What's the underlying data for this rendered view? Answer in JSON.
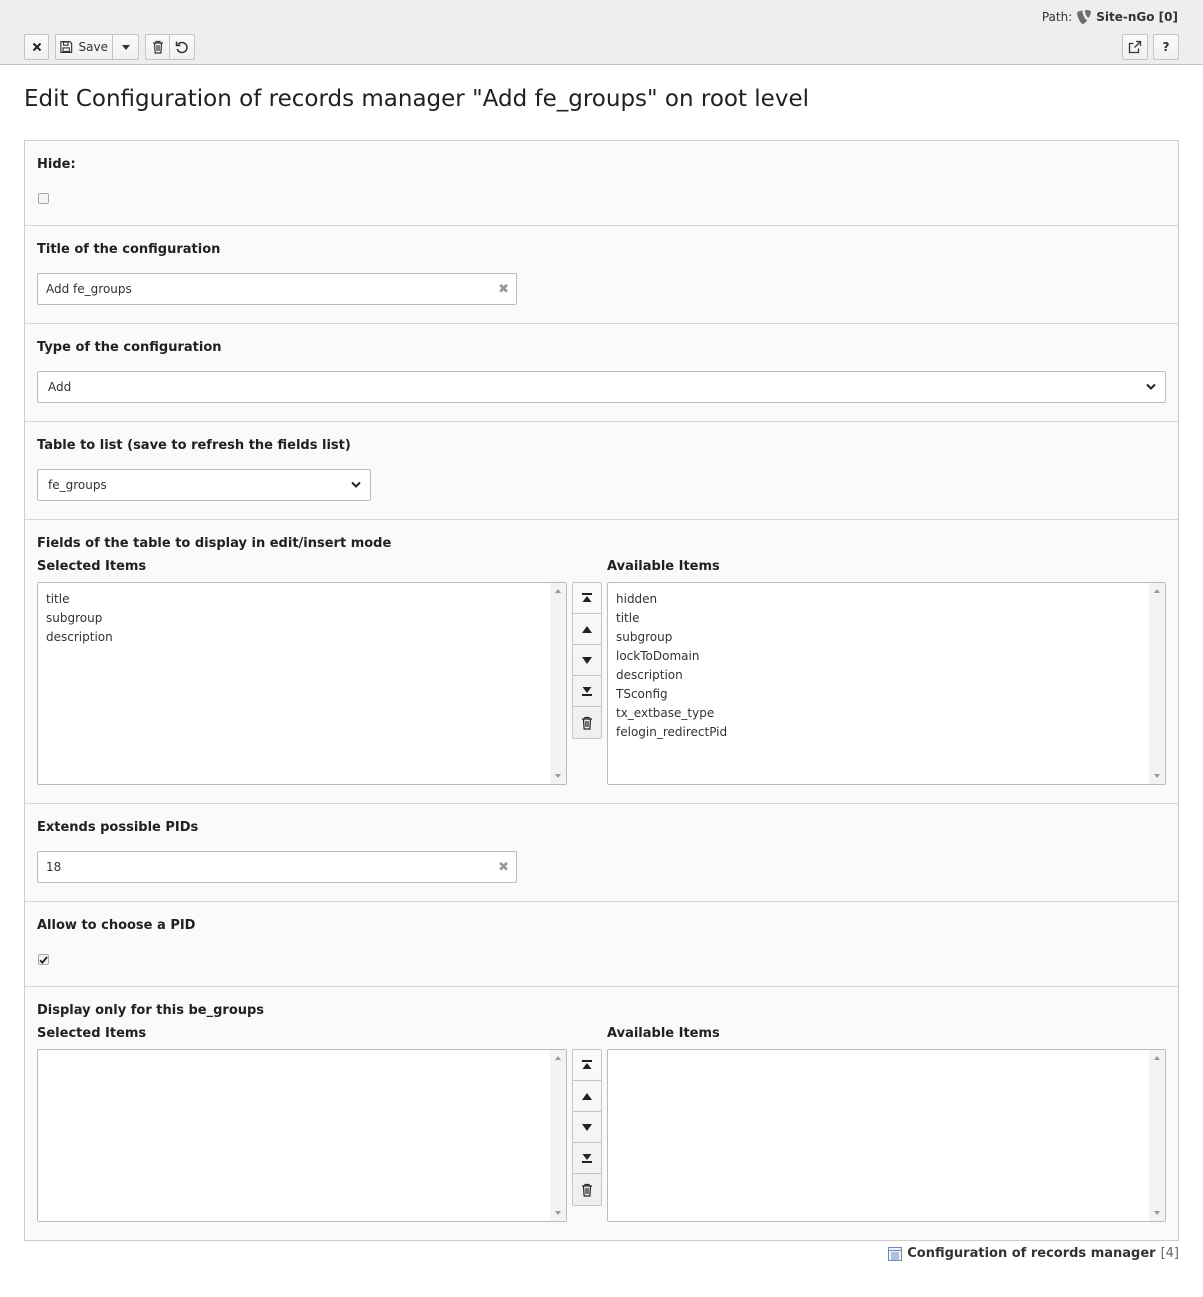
{
  "docheader": {
    "path_label": "Path:",
    "site_name": "Site-nGo [0]",
    "save_label": "Save",
    "help_label": "?"
  },
  "page": {
    "title": "Edit Configuration of records manager \"Add fe_groups\" on root level"
  },
  "form": {
    "hide": {
      "label": "Hide:",
      "checked": false
    },
    "title_field": {
      "label": "Title of the configuration",
      "value": "Add fe_groups"
    },
    "type_field": {
      "label": "Type of the configuration",
      "value": "Add"
    },
    "table_field": {
      "label": "Table to list (save to refresh the fields list)",
      "value": "fe_groups"
    },
    "fields": {
      "label": "Fields of the table to display in edit/insert mode",
      "selected_label": "Selected Items",
      "available_label": "Available Items",
      "selected": [
        "title",
        "subgroup",
        "description"
      ],
      "available": [
        "hidden",
        "title",
        "subgroup",
        "lockToDomain",
        "description",
        "TSconfig",
        "tx_extbase_type",
        "felogin_redirectPid"
      ]
    },
    "pids": {
      "label": "Extends possible PIDs",
      "value": "18"
    },
    "allow_pid": {
      "label": "Allow to choose a PID",
      "checked": true
    },
    "be_groups": {
      "label": "Display only for this be_groups",
      "selected_label": "Selected Items",
      "available_label": "Available Items",
      "selected": [],
      "available": []
    }
  },
  "footer": {
    "record_type": "Configuration of records manager",
    "record_id": "[4]"
  }
}
